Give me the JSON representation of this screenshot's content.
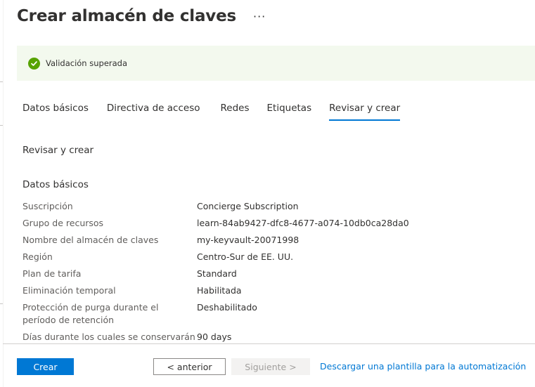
{
  "header": {
    "title": "Crear almacén de claves",
    "more_label": "···"
  },
  "banner": {
    "icon": "check-circle-icon",
    "text": "Validación superada",
    "color": "#57a300",
    "background": "#f3f9ee"
  },
  "tabs": [
    {
      "label": "Datos básicos",
      "active": false
    },
    {
      "label": "Directiva de acceso",
      "active": false
    },
    {
      "label": "Redes",
      "active": false
    },
    {
      "label": "Etiquetas",
      "active": false
    },
    {
      "label": "Revisar y crear",
      "active": true
    }
  ],
  "review": {
    "heading": "Revisar y crear",
    "section": "Datos básicos",
    "rows": [
      {
        "label": "Suscripción",
        "value": "Concierge Subscription"
      },
      {
        "label": "Grupo de recursos",
        "value": "learn-84ab9427-dfc8-4677-a074-10db0ca28da0"
      },
      {
        "label": "Nombre del almacén de claves",
        "value": "my-keyvault-20071998"
      },
      {
        "label": "Región",
        "value": "Centro-Sur de EE. UU."
      },
      {
        "label": "Plan de tarifa",
        "value": "Standard"
      },
      {
        "label": "Eliminación temporal",
        "value": "Habilitada"
      },
      {
        "label": "Protección de purga durante el período de retención",
        "value": "Deshabilitado"
      },
      {
        "label": "Días durante los cuales se conservarán",
        "value": "90 days"
      }
    ]
  },
  "footer": {
    "create_label": "Crear",
    "previous_label": "< anterior",
    "next_label": "Siguiente >",
    "download_link": "Descargar una plantilla para la automatización"
  },
  "colors": {
    "accent": "#0078d4",
    "success": "#57a300"
  }
}
